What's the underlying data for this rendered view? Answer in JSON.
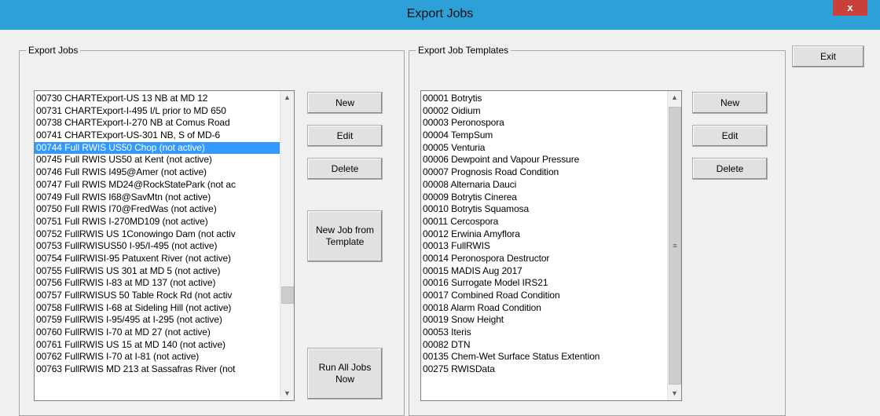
{
  "window": {
    "title": "Export Jobs",
    "close_glyph": "x"
  },
  "export_jobs": {
    "group_label": "Export Jobs",
    "items": [
      "00730 CHARTExport-US 13 NB at MD 12",
      "00731 CHARTExport-I-495 I/L prior to MD 650",
      "00738 CHARTExport-I-270 NB at Comus Road",
      "00741 CHARTExport-US-301 NB, S of MD-6",
      "00744 Full RWIS US50 Chop (not active)",
      "00745 Full RWIS US50 at Kent (not active)",
      "00746 Full RWIS I495@Amer (not active)",
      "00747 Full RWIS MD24@RockStatePark (not ac",
      "00749 Full RWIS I68@SavMtn (not active)",
      "00750 Full RWIS I70@FredWas (not active)",
      "00751 Full RWIS I-270MD109 (not active)",
      "00752 FullRWIS US 1Conowingo Dam (not activ",
      "00753 FullRWISUS50 I-95/I-495 (not active)",
      "00754 FullRWISI-95 Patuxent River (not active)",
      "00755 FullRWIS US 301 at MD 5 (not active)",
      "00756 FullRWIS I-83 at MD 137 (not active)",
      "00757 FullRWISUS 50 Table Rock Rd (not activ",
      "00758 FullRWIS I-68 at Sideling Hill  (not active)",
      "00759 FullRWIS I-95/495 at I-295 (not active)",
      "00760 FullRWIS I-70 at MD 27 (not active)",
      "00761 FullRWIS US 15 at MD 140 (not active)",
      "00762 FullRWIS I-70 at I-81 (not active)",
      "00763 FullRWIS MD 213 at Sassafras River (not"
    ],
    "selected_index": 4,
    "buttons": {
      "new": "New",
      "edit": "Edit",
      "delete": "Delete",
      "new_from_template_line1": "New Job from",
      "new_from_template_line2": "Template",
      "run_all_line1": "Run All Jobs",
      "run_all_line2": "Now"
    }
  },
  "export_job_templates": {
    "group_label": "Export Job Templates",
    "items": [
      "00001 Botrytis",
      "00002 Oidium",
      "00003 Peronospora",
      "00004 TempSum",
      "00005 Venturia",
      "00006 Dewpoint and Vapour Pressure",
      "00007 Prognosis Road Condition",
      "00008 Alternaria Dauci",
      "00009 Botrytis Cinerea",
      "00010 Botrytis Squamosa",
      "00011 Cercospora",
      "00012 Erwinia Amyflora",
      "00013 FullRWIS",
      "00014 Peronospora Destructor",
      "00015 MADIS Aug 2017",
      "00016 Surrogate Model IRS21",
      "00017 Combined Road Condition",
      "00018 Alarm Road Condition",
      "00019 Snow Height",
      "00053 Iteris",
      "00082 DTN",
      "00135 Chem-Wet Surface Status Extention",
      "00275 RWISData"
    ],
    "buttons": {
      "new": "New",
      "edit": "Edit",
      "delete": "Delete"
    }
  },
  "exit_button": "Exit",
  "icons": {
    "scroll_up": "▲",
    "scroll_down": "▼",
    "thumb_grip": "≡"
  }
}
